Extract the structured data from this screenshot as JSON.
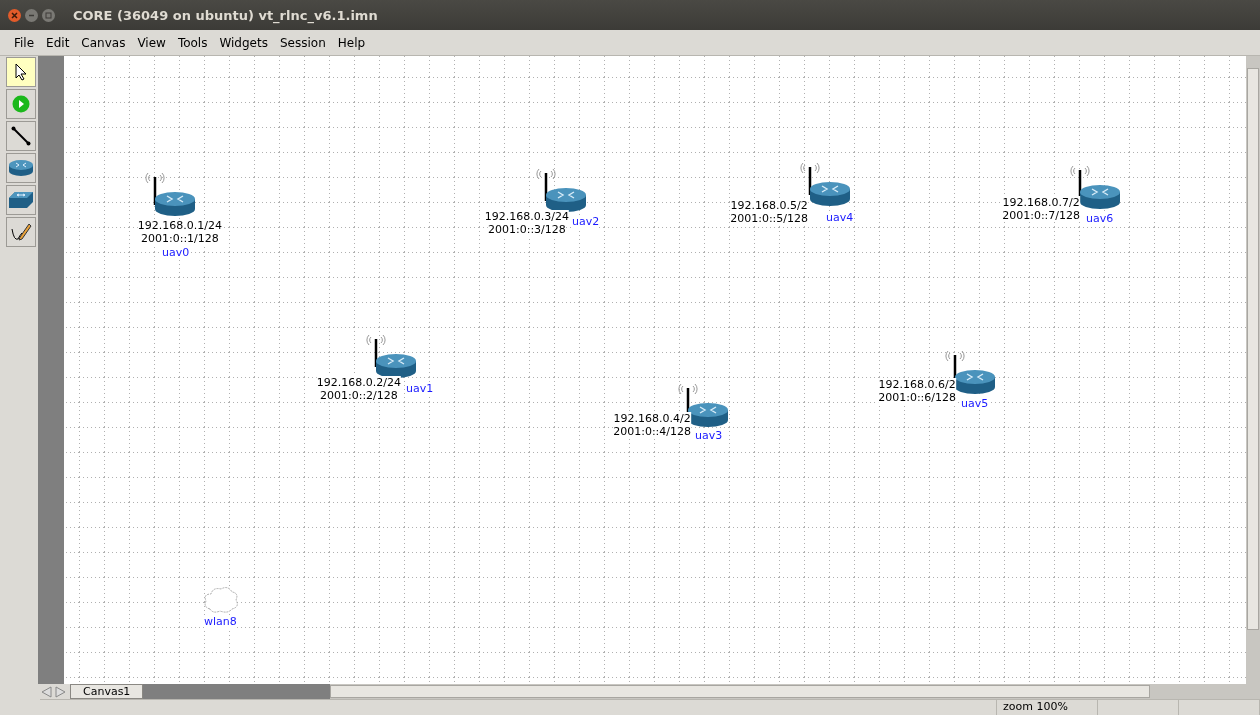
{
  "window": {
    "title": "CORE (36049 on ubuntu) vt_rlnc_v6.1.imn"
  },
  "menu": [
    "File",
    "Edit",
    "Canvas",
    "View",
    "Tools",
    "Widgets",
    "Session",
    "Help"
  ],
  "tools": [
    {
      "kind": "select",
      "selected": true
    },
    {
      "kind": "start",
      "selected": false
    },
    {
      "kind": "link",
      "selected": false
    },
    {
      "kind": "router",
      "selected": false
    },
    {
      "kind": "switch",
      "selected": false
    },
    {
      "kind": "draw",
      "selected": false
    }
  ],
  "nodes": [
    {
      "kind": "router",
      "name": "uav0",
      "ipv4": "192.168.0.1/24",
      "ipv6": "2001:0::1/128"
    },
    {
      "kind": "router",
      "name": "uav2",
      "ipv4": "192.168.0.3/24",
      "ipv6": "2001:0::3/128"
    },
    {
      "kind": "router",
      "name": "uav4",
      "ipv4": "192.168.0.5/2",
      "ipv6": "2001:0::5/128"
    },
    {
      "kind": "router",
      "name": "uav6",
      "ipv4": "192.168.0.7/2",
      "ipv6": "2001:0::7/128"
    },
    {
      "kind": "router",
      "name": "uav1",
      "ipv4": "192.168.0.2/24",
      "ipv6": "2001:0::2/128"
    },
    {
      "kind": "router",
      "name": "uav3",
      "ipv4": "192.168.0.4/2",
      "ipv6": "2001:0::4/128"
    },
    {
      "kind": "router",
      "name": "uav5",
      "ipv4": "192.168.0.6/2",
      "ipv6": "2001:0::6/128"
    },
    {
      "kind": "wlan",
      "name": "wlan8"
    }
  ],
  "canvas_tabs": [
    {
      "label": "Canvas1",
      "selected": true
    }
  ],
  "status_bar": {
    "zoom": "zoom 100%"
  }
}
